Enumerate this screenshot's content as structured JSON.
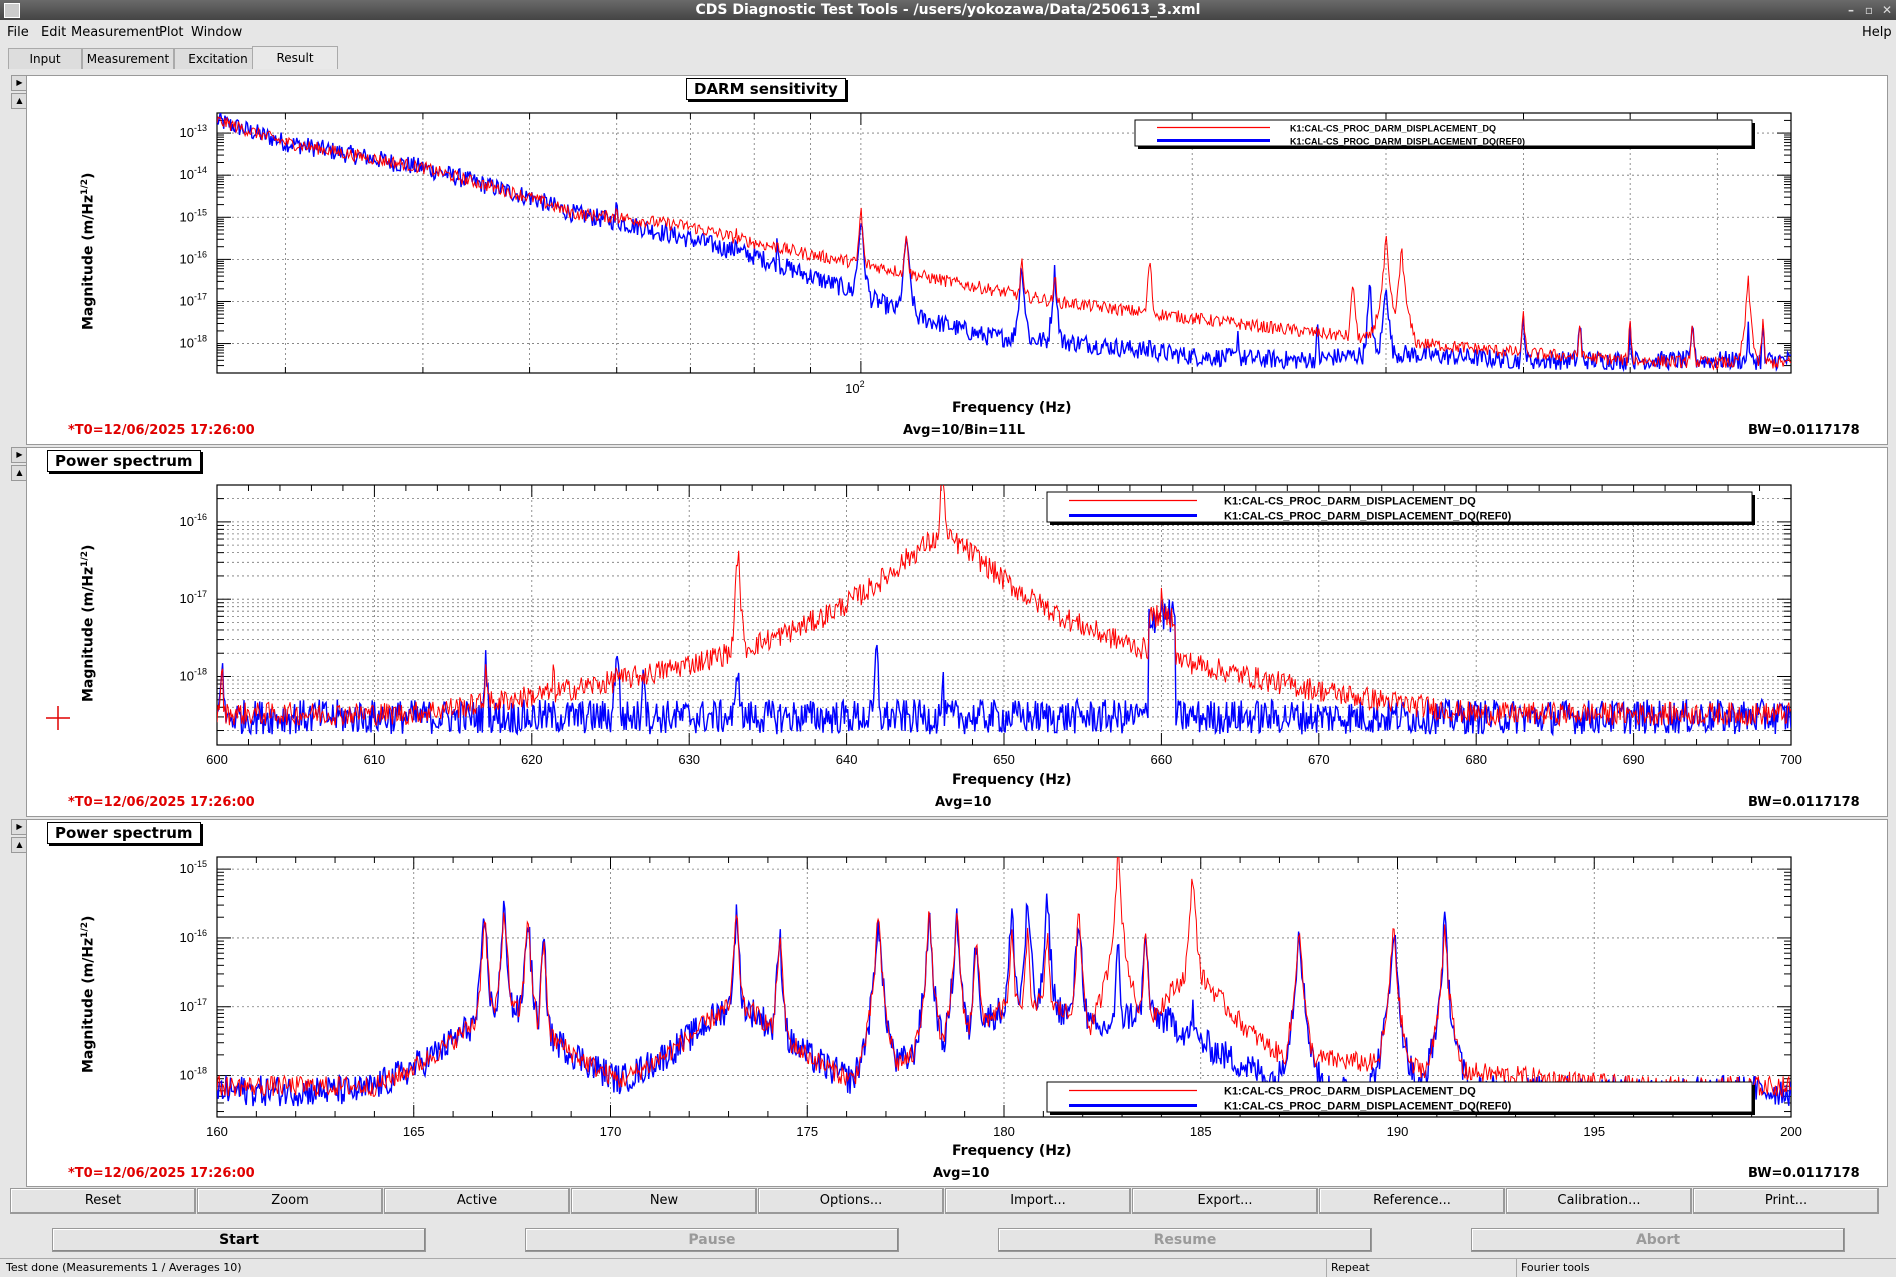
{
  "window": {
    "title": "CDS Diagnostic Test Tools - /users/yokozawa/Data/250613_3.xml"
  },
  "menu": {
    "items": [
      "File",
      "Edit",
      "Measurement",
      "Plot",
      "Window"
    ],
    "help": "Help"
  },
  "tabs": [
    "Input",
    "Measurement",
    "Excitation",
    "Result"
  ],
  "panels": [
    {
      "title": "DARM sensitivity",
      "t0": "*T0=12/06/2025 17:26:00",
      "avg": "Avg=10/Bin=11L",
      "bw": "BW=0.0117178",
      "ylabel": "Magnitude (m/Hz",
      "ylabel_sup": "1/2",
      "ylabel_end": ")",
      "xlabel": "Frequency (Hz)"
    },
    {
      "title": "Power spectrum",
      "t0": "*T0=12/06/2025 17:26:00",
      "avg": "Avg=10",
      "bw": "BW=0.0117178",
      "ylabel": "Magnitude (m/Hz",
      "ylabel_sup": "1/2",
      "ylabel_end": ")",
      "xlabel": "Frequency (Hz)"
    },
    {
      "title": "Power spectrum",
      "t0": "*T0=12/06/2025 17:26:00",
      "avg": "Avg=10",
      "bw": "BW=0.0117178",
      "ylabel": "Magnitude (m/Hz",
      "ylabel_sup": "1/2",
      "ylabel_end": ")",
      "xlabel": "Frequency (Hz)"
    }
  ],
  "buttons": [
    "Reset",
    "Zoom",
    "Active",
    "New",
    "Options...",
    "Import...",
    "Export...",
    "Reference...",
    "Calibration...",
    "Print..."
  ],
  "run_buttons": [
    {
      "label": "Start",
      "enabled": true
    },
    {
      "label": "Pause",
      "enabled": false
    },
    {
      "label": "Resume",
      "enabled": false
    },
    {
      "label": "Abort",
      "enabled": false
    }
  ],
  "status": {
    "left": "Test done (Measurements 1 / Averages 10)",
    "mid": "Repeat",
    "right": "Fourier tools"
  },
  "colors": {
    "current": "#ff0000",
    "reference": "#0000ff",
    "t0": "#e00000"
  },
  "chart_data": [
    {
      "type": "line",
      "title": "DARM sensitivity",
      "xscale": "log",
      "yscale": "log",
      "xlim": [
        26,
        700
      ],
      "ylim": [
        2e-19,
        3e-13
      ],
      "xticks_labeled": [
        {
          "value": 100,
          "label": "10^2"
        }
      ],
      "yticks": [
        1e-13,
        1e-14,
        1e-15,
        1e-16,
        1e-17,
        1e-18
      ],
      "ytick_labels": [
        "10^-13",
        "10^-14",
        "10^-15",
        "10^-16",
        "10^-17",
        "10^-18"
      ],
      "xlabel": "Frequency (Hz)",
      "ylabel": "Magnitude (m/Hz^1/2)",
      "grid": true,
      "legend": "top-right",
      "series": [
        {
          "name": "K1:CAL-CS_PROC_DARM_DISPLACEMENT_DQ",
          "color": "#ff0000",
          "points": [
            [
              26,
              2e-13
            ],
            [
              30,
              6e-14
            ],
            [
              40,
              1.5e-14
            ],
            [
              50,
              3e-15
            ],
            [
              55,
              1.2e-15
            ],
            [
              60,
              1e-15
            ],
            [
              70,
              6e-16
            ],
            [
              80,
              2.5e-16
            ],
            [
              90,
              1.3e-16
            ],
            [
              100,
              8e-17
            ],
            [
              120,
              3e-17
            ],
            [
              150,
              1e-17
            ],
            [
              200,
              4e-18
            ],
            [
              250,
              2e-18
            ],
            [
              300,
              1.2e-18
            ],
            [
              400,
              6e-19
            ],
            [
              500,
              4e-19
            ],
            [
              600,
              3.5e-19
            ],
            [
              700,
              3.5e-19
            ]
          ],
          "peaks": [
            [
              35,
              4e-15
            ],
            [
              40,
              3e-15
            ],
            [
              52,
              1e-15
            ],
            [
              60,
              2e-15
            ],
            [
              72,
              5e-16
            ],
            [
              77,
              5e-16
            ],
            [
              84,
              3e-16
            ],
            [
              100,
              1.5e-15
            ],
            [
              110,
              5e-16
            ],
            [
              140,
              1e-16
            ],
            [
              150,
              5e-17
            ],
            [
              183,
              1e-16
            ],
            [
              280,
              3e-17
            ],
            [
              300,
              3e-16
            ],
            [
              310,
              2e-16
            ],
            [
              400,
              5e-18
            ],
            [
              450,
              3e-18
            ],
            [
              500,
              3e-18
            ],
            [
              570,
              3e-18
            ],
            [
              640,
              3e-17
            ],
            [
              660,
              3e-18
            ]
          ]
        },
        {
          "name": "K1:CAL-CS_PROC_DARM_DISPLACEMENT_DQ(REF0)",
          "color": "#0000ff",
          "points": [
            [
              26,
              2e-13
            ],
            [
              30,
              6e-14
            ],
            [
              40,
              1.5e-14
            ],
            [
              50,
              3e-15
            ],
            [
              55,
              1.2e-15
            ],
            [
              60,
              8e-16
            ],
            [
              70,
              3e-16
            ],
            [
              80,
              1.2e-16
            ],
            [
              90,
              4e-17
            ],
            [
              100,
              1.5e-17
            ],
            [
              110,
              5e-18
            ],
            [
              130,
              1.5e-18
            ],
            [
              160,
              1e-18
            ],
            [
              200,
              5e-19
            ],
            [
              250,
              4e-19
            ],
            [
              300,
              6e-19
            ],
            [
              400,
              4e-19
            ],
            [
              500,
              4e-19
            ],
            [
              600,
              4e-19
            ],
            [
              700,
              4e-19
            ]
          ],
          "peaks": [
            [
              35,
              4e-15
            ],
            [
              40,
              3e-15
            ],
            [
              60,
              2e-15
            ],
            [
              72,
              4e-16
            ],
            [
              77,
              4e-16
            ],
            [
              84,
              3e-16
            ],
            [
              100,
              1e-15
            ],
            [
              110,
              4e-16
            ],
            [
              140,
              8e-17
            ],
            [
              150,
              5e-17
            ],
            [
              183,
              1.5e-18
            ],
            [
              220,
              2e-18
            ],
            [
              260,
              2e-18
            ],
            [
              290,
              2e-17
            ],
            [
              300,
              3e-17
            ],
            [
              400,
              4e-18
            ],
            [
              450,
              3e-18
            ],
            [
              500,
              2e-18
            ],
            [
              570,
              3e-18
            ],
            [
              640,
              2e-18
            ],
            [
              660,
              2e-18
            ]
          ]
        }
      ]
    },
    {
      "type": "line",
      "title": "Power spectrum",
      "xscale": "linear",
      "yscale": "log",
      "xlim": [
        600,
        700
      ],
      "ylim": [
        1.3e-19,
        3e-16
      ],
      "xticks": [
        600,
        610,
        620,
        630,
        640,
        650,
        660,
        670,
        680,
        690,
        700
      ],
      "yticks": [
        1e-16,
        1e-17,
        1e-18
      ],
      "ytick_labels": [
        "10^-16",
        "10^-17",
        "10^-18"
      ],
      "xlabel": "Frequency (Hz)",
      "ylabel": "Magnitude (m/Hz^1/2)",
      "grid": true,
      "legend": "top-right",
      "series": [
        {
          "name": "K1:CAL-CS_PROC_DARM_DISPLACEMENT_DQ",
          "color": "#ff0000",
          "baseline": 3.3e-19,
          "peaks": [
            [
              600.3,
              1.2e-18
            ],
            [
              617.1,
              1.5e-18
            ],
            [
              621.4,
              1.2e-18
            ],
            [
              625.4,
              1.5e-18
            ],
            [
              627.1,
              1e-18
            ],
            [
              633.1,
              4e-17
            ],
            [
              641.9,
              1.5e-18
            ],
            [
              646.1,
              5e-16
            ],
            [
              660,
              1e-17
            ]
          ]
        },
        {
          "name": "K1:CAL-CS_PROC_DARM_DISPLACEMENT_DQ(REF0)",
          "color": "#0000ff",
          "baseline": 3e-19,
          "peaks": [
            [
              600.3,
              1.5e-18
            ],
            [
              617.1,
              1.5e-18
            ],
            [
              625.4,
              2.5e-18
            ],
            [
              627.1,
              1.5e-18
            ],
            [
              633.1,
              1.5e-18
            ],
            [
              641.9,
              2e-18
            ],
            [
              646.1,
              8e-19
            ],
            [
              660,
              1e-17
            ]
          ]
        }
      ]
    },
    {
      "type": "line",
      "title": "Power spectrum",
      "xscale": "linear",
      "yscale": "log",
      "xlim": [
        160,
        200
      ],
      "ylim": [
        2.5e-19,
        1.5e-15
      ],
      "xticks": [
        160,
        165,
        170,
        175,
        180,
        185,
        190,
        195,
        200
      ],
      "yticks": [
        1e-15,
        1e-16,
        1e-17,
        1e-18
      ],
      "ytick_labels": [
        "10^-15",
        "10^-16",
        "10^-17",
        "10^-18"
      ],
      "xlabel": "Frequency (Hz)",
      "ylabel": "Magnitude (m/Hz^1/2)",
      "grid": true,
      "legend": "bottom-right",
      "series": [
        {
          "name": "K1:CAL-CS_PROC_DARM_DISPLACEMENT_DQ",
          "color": "#ff0000",
          "peaks": [
            [
              166.8,
              2e-16
            ],
            [
              167.3,
              2.5e-16
            ],
            [
              167.9,
              2e-16
            ],
            [
              168.3,
              8e-17
            ],
            [
              173.2,
              2e-16
            ],
            [
              174.3,
              1e-16
            ],
            [
              176.8,
              2e-16
            ],
            [
              178.1,
              2e-16
            ],
            [
              178.8,
              2e-16
            ],
            [
              179.3,
              1e-16
            ],
            [
              180.2,
              1e-16
            ],
            [
              180.6,
              1e-16
            ],
            [
              181.1,
              1e-16
            ],
            [
              181.9,
              2e-16
            ],
            [
              182.9,
              1.5e-15
            ],
            [
              183.6,
              1e-16
            ],
            [
              184.8,
              8e-16
            ],
            [
              187.5,
              1.5e-16
            ],
            [
              189.9,
              1.5e-16
            ],
            [
              191.2,
              1.5e-16
            ]
          ]
        },
        {
          "name": "K1:CAL-CS_PROC_DARM_DISPLACEMENT_DQ(REF0)",
          "color": "#0000ff",
          "peaks": [
            [
              166.8,
              2e-16
            ],
            [
              167.3,
              2.5e-16
            ],
            [
              167.9,
              2e-16
            ],
            [
              168.3,
              8e-17
            ],
            [
              173.2,
              2e-16
            ],
            [
              174.3,
              1e-16
            ],
            [
              176.8,
              2e-16
            ],
            [
              178.1,
              2e-16
            ],
            [
              178.8,
              2e-16
            ],
            [
              179.3,
              1e-16
            ],
            [
              180.2,
              2e-16
            ],
            [
              180.6,
              3e-16
            ],
            [
              181.1,
              3e-16
            ],
            [
              181.9,
              2e-16
            ],
            [
              182.9,
              6e-17
            ],
            [
              183.6,
              1e-16
            ],
            [
              184.8,
              1e-17
            ],
            [
              187.5,
              1.5e-16
            ],
            [
              189.9,
              1.5e-16
            ],
            [
              191.2,
              1.5e-16
            ]
          ]
        }
      ]
    }
  ]
}
